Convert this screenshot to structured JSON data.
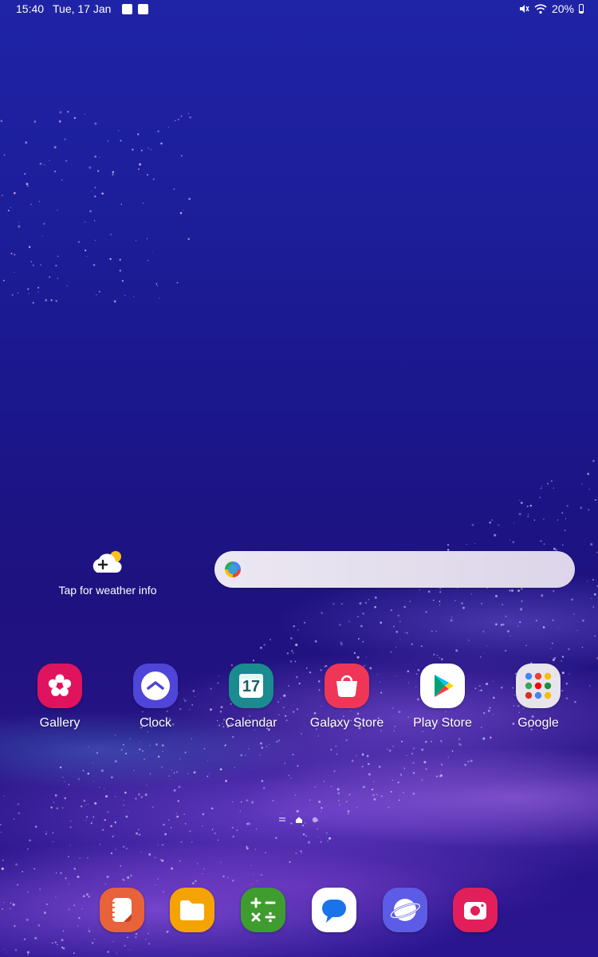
{
  "status_bar": {
    "time": "15:40",
    "date": "Tue, 17 Jan",
    "battery": "20%"
  },
  "weather_widget": {
    "label": "Tap for weather info"
  },
  "apps": [
    {
      "name": "gallery",
      "label": "Gallery",
      "color": "#e0135e"
    },
    {
      "name": "clock",
      "label": "Clock",
      "color": "#4f45d8"
    },
    {
      "name": "calendar",
      "label": "Calendar",
      "color": "#1a8b8f",
      "badge": "17"
    },
    {
      "name": "galaxy-store",
      "label": "Galaxy Store",
      "color": "#f03657"
    },
    {
      "name": "play-store",
      "label": "Play Store",
      "color": "#ffffff"
    },
    {
      "name": "google",
      "label": "Google",
      "color": "#e8e4ec"
    }
  ],
  "page_indicator": {
    "pages": 3,
    "current": 2
  },
  "dock": [
    {
      "name": "notes",
      "color": "#e8623a"
    },
    {
      "name": "my-files",
      "color": "#f5a300"
    },
    {
      "name": "calculator",
      "color": "#3f9d2f"
    },
    {
      "name": "messages",
      "color": "#ffffff"
    },
    {
      "name": "internet",
      "color": "#5c5ce6"
    },
    {
      "name": "camera",
      "color": "#e21f5a"
    }
  ]
}
